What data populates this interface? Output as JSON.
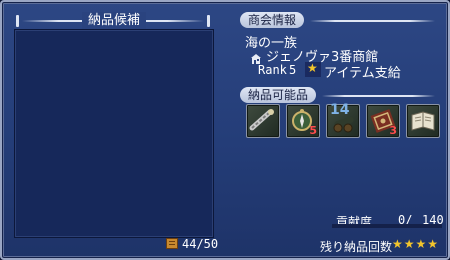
{
  "left_panel": {
    "title": "納品候補",
    "capacity": "44/50",
    "capacity_icon": "cargo-crate-icon"
  },
  "guild_info": {
    "title": "商会情報",
    "guild_name": "海の一族",
    "building_icon": "building-icon",
    "building_name": "ジェノヴァ3番商館",
    "rank_label": "Rank",
    "rank_value": "5",
    "support_icon": "star-icon",
    "support_text": "アイテム支給"
  },
  "deliverable": {
    "title": "納品可能品",
    "items": [
      {
        "icon": "rope-tool-icon",
        "count": ""
      },
      {
        "icon": "compass-icon",
        "count": "5"
      },
      {
        "icon": "cannon-icon",
        "count": "14"
      },
      {
        "icon": "carpet-icon",
        "count": "3"
      },
      {
        "icon": "book-icon",
        "count": ""
      }
    ]
  },
  "footer": {
    "contribution_label": "貢献度",
    "contribution_value": "0/",
    "contribution_max": "140",
    "contribution_ratio": 0,
    "remaining_label": "残り納品回数",
    "remaining_stars": "★★★★",
    "remaining_count": 4
  },
  "colors": {
    "panel_bg": "#243d78",
    "accent_star": "#f3c52c",
    "count_red": "#ff4d4d"
  }
}
